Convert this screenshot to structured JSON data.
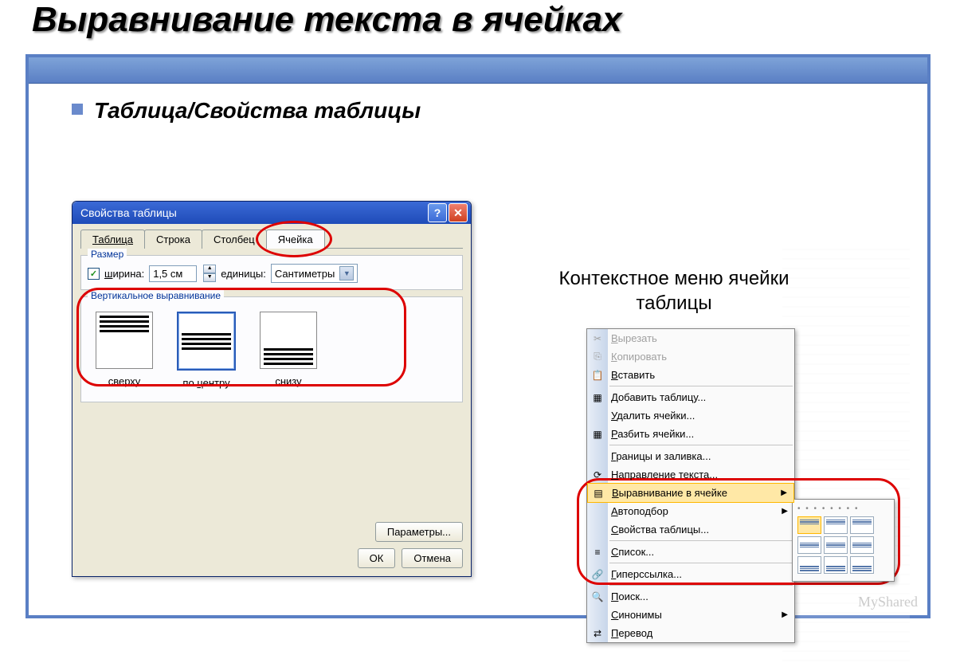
{
  "slide": {
    "title": "Выравнивание текста в ячейках",
    "subtitle": "Таблица/Свойства таблицы",
    "context_label": "Контекстное меню ячейки таблицы",
    "watermark": "MyShared"
  },
  "dialog": {
    "title": "Свойства таблицы",
    "tabs": [
      "Таблица",
      "Строка",
      "Столбец",
      "Ячейка"
    ],
    "size_group": "Размер",
    "width_label": "ширина:",
    "width_value": "1,5 см",
    "units_label": "единицы:",
    "units_value": "Сантиметры",
    "valign_group": "Вертикальное выравнивание",
    "valign_options": [
      "сверху",
      "по центру",
      "снизу"
    ],
    "params_btn": "Параметры...",
    "ok": "ОК",
    "cancel": "Отмена"
  },
  "context_menu": {
    "items": [
      {
        "label": "Вырезать",
        "hot": "В",
        "icon": "✂",
        "disabled": true
      },
      {
        "label": "Копировать",
        "hot": "К",
        "icon": "⎘",
        "disabled": true
      },
      {
        "label": "Вставить",
        "hot": "В",
        "icon": "📋"
      },
      {
        "sep": true
      },
      {
        "label": "Добавить таблицу...",
        "hot": "Д",
        "icon": "▦"
      },
      {
        "label": "Удалить ячейки...",
        "hot": "У"
      },
      {
        "label": "Разбить ячейки...",
        "hot": "Р",
        "icon": "▦"
      },
      {
        "sep": true
      },
      {
        "label": "Границы и заливка...",
        "hot": "Г"
      },
      {
        "label": "Направление текста...",
        "hot": "Н",
        "icon": "⟳"
      },
      {
        "label": "Выравнивание в ячейке",
        "hot": "В",
        "icon": "▤",
        "arrow": true,
        "hl": true
      },
      {
        "label": "Автоподбор",
        "hot": "А",
        "arrow": true
      },
      {
        "label": "Свойства таблицы...",
        "hot": "С"
      },
      {
        "sep": true
      },
      {
        "label": "Список...",
        "hot": "С",
        "icon": "≡"
      },
      {
        "sep": true
      },
      {
        "label": "Гиперссылка...",
        "hot": "Г",
        "icon": "🔗"
      },
      {
        "sep": true
      },
      {
        "label": "Поиск...",
        "hot": "П",
        "icon": "🔍"
      },
      {
        "label": "Синонимы",
        "hot": "С",
        "arrow": true
      },
      {
        "label": "Перевод",
        "hot": "П",
        "icon": "⇄"
      }
    ]
  }
}
